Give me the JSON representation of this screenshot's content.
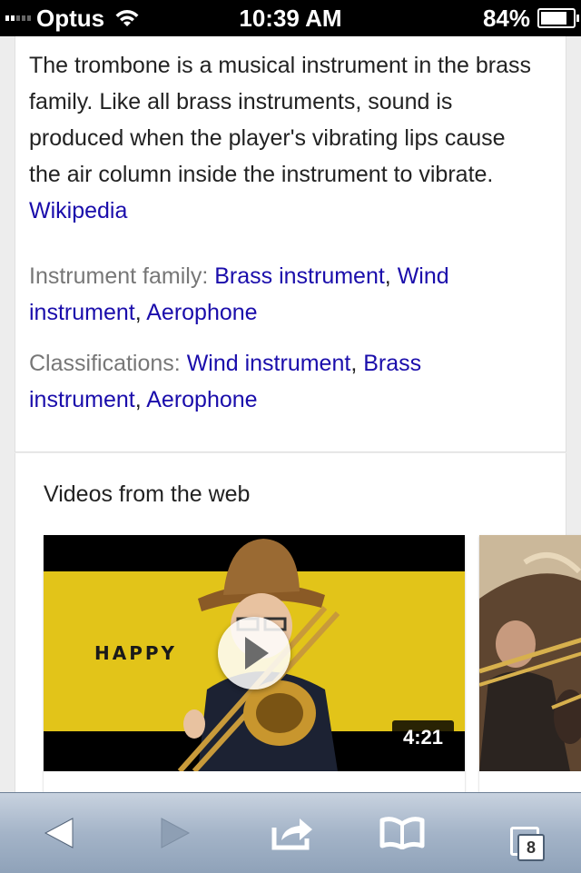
{
  "status_bar": {
    "carrier": "Optus",
    "time": "10:39 AM",
    "battery": "84%"
  },
  "knowledge_panel": {
    "description": "The trombone is a musical instrument in the brass family. Like all brass instruments, sound is produced when the player's vibrating lips cause the air column inside the instrument to vibrate.",
    "source_link": "Wikipedia",
    "facts": [
      {
        "label": "Instrument family:",
        "values": [
          "Brass instrument",
          "Wind instrument",
          "Aerophone"
        ]
      },
      {
        "label": "Classifications:",
        "values": [
          "Wind instrument",
          "Brass instrument",
          "Aerophone"
        ]
      }
    ]
  },
  "videos": {
    "heading": "Videos from the web",
    "items": [
      {
        "thumbnail_text": "HAPPY",
        "duration": "4:21"
      },
      {
        "thumbnail_text": "",
        "duration": ""
      }
    ]
  },
  "toolbar": {
    "tab_count": "8",
    "icons": [
      "back-arrow-icon",
      "forward-arrow-icon",
      "share-icon",
      "bookmarks-icon",
      "tabs-icon"
    ]
  },
  "colors": {
    "link": "#1a0dab",
    "label": "#777777",
    "thumbnail_yellow": "#e2c419"
  }
}
